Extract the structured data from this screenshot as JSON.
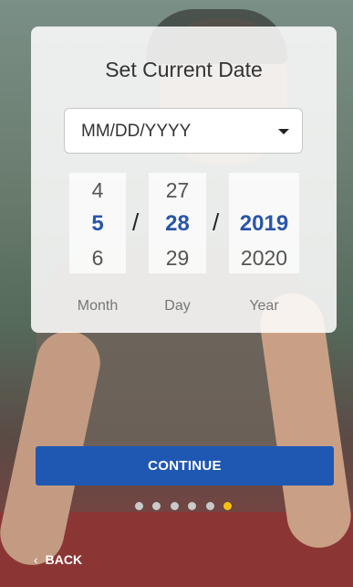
{
  "card": {
    "title": "Set Current Date",
    "format_select": {
      "value": "MM/DD/YYYY"
    }
  },
  "picker": {
    "month": {
      "label": "Month",
      "values": [
        "4",
        "5",
        "6"
      ],
      "selected": "5"
    },
    "day": {
      "label": "Day",
      "values": [
        "27",
        "28",
        "29"
      ],
      "selected": "28"
    },
    "year": {
      "label": "Year",
      "values": [
        "",
        "2019",
        "2020"
      ],
      "selected": "2019"
    },
    "separator": "/"
  },
  "actions": {
    "continue_label": "CONTINUE",
    "back_label": "BACK"
  },
  "pager": {
    "total": 6,
    "active_index": 5
  },
  "colors": {
    "primary": "#1f58b2",
    "selected_text": "#2a55a7",
    "active_dot": "#f4c20d"
  }
}
